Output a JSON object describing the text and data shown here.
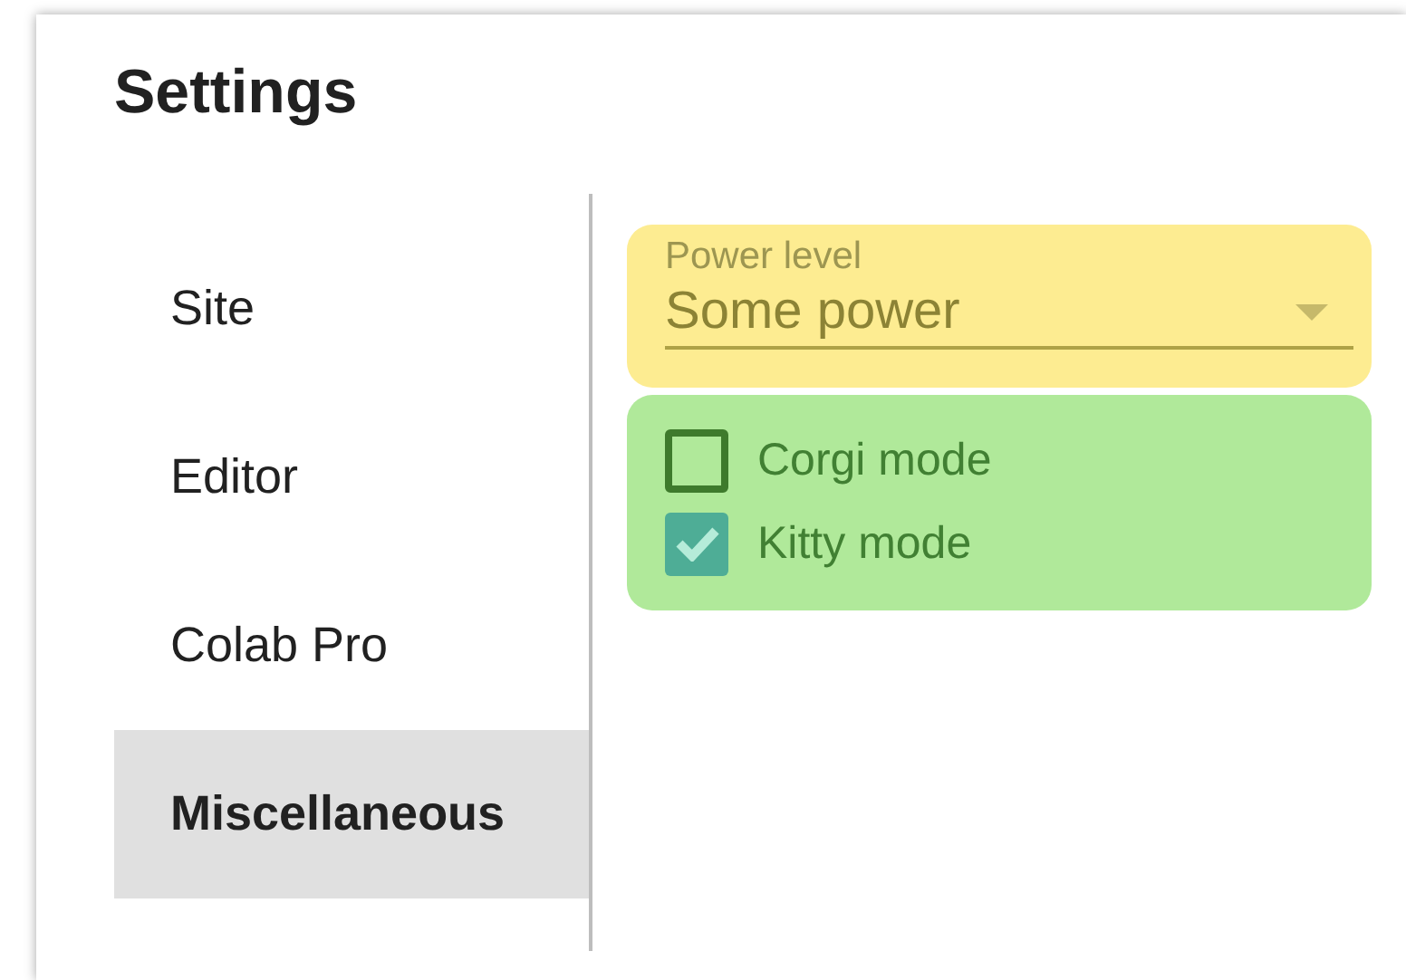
{
  "dialog": {
    "title": "Settings"
  },
  "sidebar": {
    "items": [
      {
        "label": "Site",
        "selected": false
      },
      {
        "label": "Editor",
        "selected": false
      },
      {
        "label": "Colab Pro",
        "selected": false
      },
      {
        "label": "Miscellaneous",
        "selected": true
      }
    ]
  },
  "power_level": {
    "label": "Power level",
    "value": "Some power"
  },
  "modes": [
    {
      "label": "Corgi mode",
      "checked": false
    },
    {
      "label": "Kitty mode",
      "checked": true
    }
  ]
}
